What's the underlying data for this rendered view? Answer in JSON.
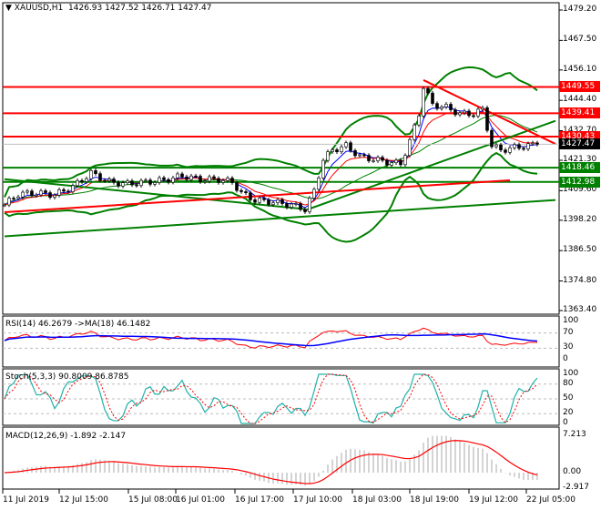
{
  "header": {
    "symbol": "XAUUSD,H1",
    "ohlc": "1426.93 1427.52 1426.71 1427.47"
  },
  "price_axis": [
    "1479.20",
    "1467.50",
    "1456.10",
    "1444.40",
    "1432.70",
    "1421.30",
    "1409.60",
    "1398.20",
    "1386.50",
    "1374.80",
    "1363.40"
  ],
  "level_tags": [
    {
      "text": "1449.55",
      "value": 1449.55,
      "color": "#ff0000"
    },
    {
      "text": "1439.41",
      "value": 1439.41,
      "color": "#ff0000"
    },
    {
      "text": "1430.43",
      "value": 1430.43,
      "color": "#ff0000"
    },
    {
      "text": "1427.47",
      "value": 1427.47,
      "color": "#000000"
    },
    {
      "text": "1418.46",
      "value": 1418.46,
      "color": "#008000"
    },
    {
      "text": "1412.98",
      "value": 1412.98,
      "color": "#008000"
    }
  ],
  "time_axis": [
    "11 Jul 2019",
    "12 Jul 15:00",
    "15 Jul 08:00",
    "16 Jul 01:00",
    "16 Jul 17:00",
    "17 Jul 10:00",
    "18 Jul 03:00",
    "18 Jul 19:00",
    "19 Jul 12:00",
    "22 Jul 05:00"
  ],
  "rsi": {
    "title": "RSI(14) 46.2679  ->MA(18) 46.1482",
    "axis": [
      "100",
      "70",
      "30",
      "0"
    ]
  },
  "stoch": {
    "title": "Stoch(5,3,3) 90.8009 86.8785",
    "axis": [
      "100",
      "80",
      "50",
      "20",
      "0"
    ]
  },
  "macd": {
    "title": "MACD(12,26,9) -1.892 -2.147",
    "axis": [
      "7.213",
      "0.00",
      "-2.917"
    ]
  },
  "chart_data": {
    "type": "line",
    "title": "XAUUSD,H1",
    "ylim": [
      1363.4,
      1479.2
    ],
    "close_keypoints": [
      [
        0,
        1404.1
      ],
      [
        3,
        1408.3
      ],
      [
        7,
        1408.7
      ],
      [
        11,
        1408.0
      ],
      [
        15,
        1411.1
      ],
      [
        19,
        1416.4
      ],
      [
        23,
        1412.9
      ],
      [
        27,
        1412.2
      ],
      [
        31,
        1412.9
      ],
      [
        35,
        1413.6
      ],
      [
        39,
        1415.3
      ],
      [
        43,
        1413.9
      ],
      [
        47,
        1413.9
      ],
      [
        50,
        1412.9
      ],
      [
        52,
        1408.7
      ],
      [
        55,
        1405.9
      ],
      [
        59,
        1405.2
      ],
      [
        63,
        1404.1
      ],
      [
        66,
        1402.4
      ],
      [
        68,
        1409.4
      ],
      [
        70,
        1421.7
      ],
      [
        72,
        1425.2
      ],
      [
        75,
        1426.9
      ],
      [
        78,
        1422.7
      ],
      [
        81,
        1421.7
      ],
      [
        84,
        1420.6
      ],
      [
        87,
        1419.9
      ],
      [
        89,
        1428.7
      ],
      [
        91,
        1439.2
      ],
      [
        92,
        1449.7
      ],
      [
        94,
        1442.7
      ],
      [
        97,
        1441.7
      ],
      [
        100,
        1439.2
      ],
      [
        103,
        1439.2
      ],
      [
        105,
        1440.9
      ],
      [
        107,
        1426.9
      ],
      [
        109,
        1425.2
      ],
      [
        112,
        1426.2
      ],
      [
        115,
        1426.9
      ],
      [
        117,
        1427.5
      ]
    ],
    "horizontal_levels": [
      {
        "value": 1449.55,
        "color": "#ff0000"
      },
      {
        "value": 1439.41,
        "color": "#ff0000"
      },
      {
        "value": 1430.43,
        "color": "#ff0000"
      },
      {
        "value": 1418.46,
        "color": "#008000"
      },
      {
        "value": 1412.98,
        "color": "#008000"
      }
    ],
    "trendlines": [
      {
        "from": [
          0,
          1392.0
        ],
        "to": [
          121,
          1406.0
        ],
        "color": "#008000"
      },
      {
        "from": [
          66,
          1402.0
        ],
        "to": [
          121,
          1436.5
        ],
        "color": "#008000"
      },
      {
        "from": [
          0,
          1414.0
        ],
        "to": [
          66,
          1402.5
        ],
        "color": "#008000"
      },
      {
        "from": [
          92,
          1452.2
        ],
        "to": [
          121,
          1427.6
        ],
        "color": "#ff0000"
      },
      {
        "from": [
          0,
          1401.3
        ],
        "to": [
          111,
          1413.6
        ],
        "color": "#ff0000"
      }
    ],
    "indicators": {
      "rsi_period": 14,
      "rsi_ma": 18,
      "stoch": [
        5,
        3,
        3
      ],
      "macd": [
        12,
        26,
        9
      ],
      "bollinger": 20
    }
  }
}
